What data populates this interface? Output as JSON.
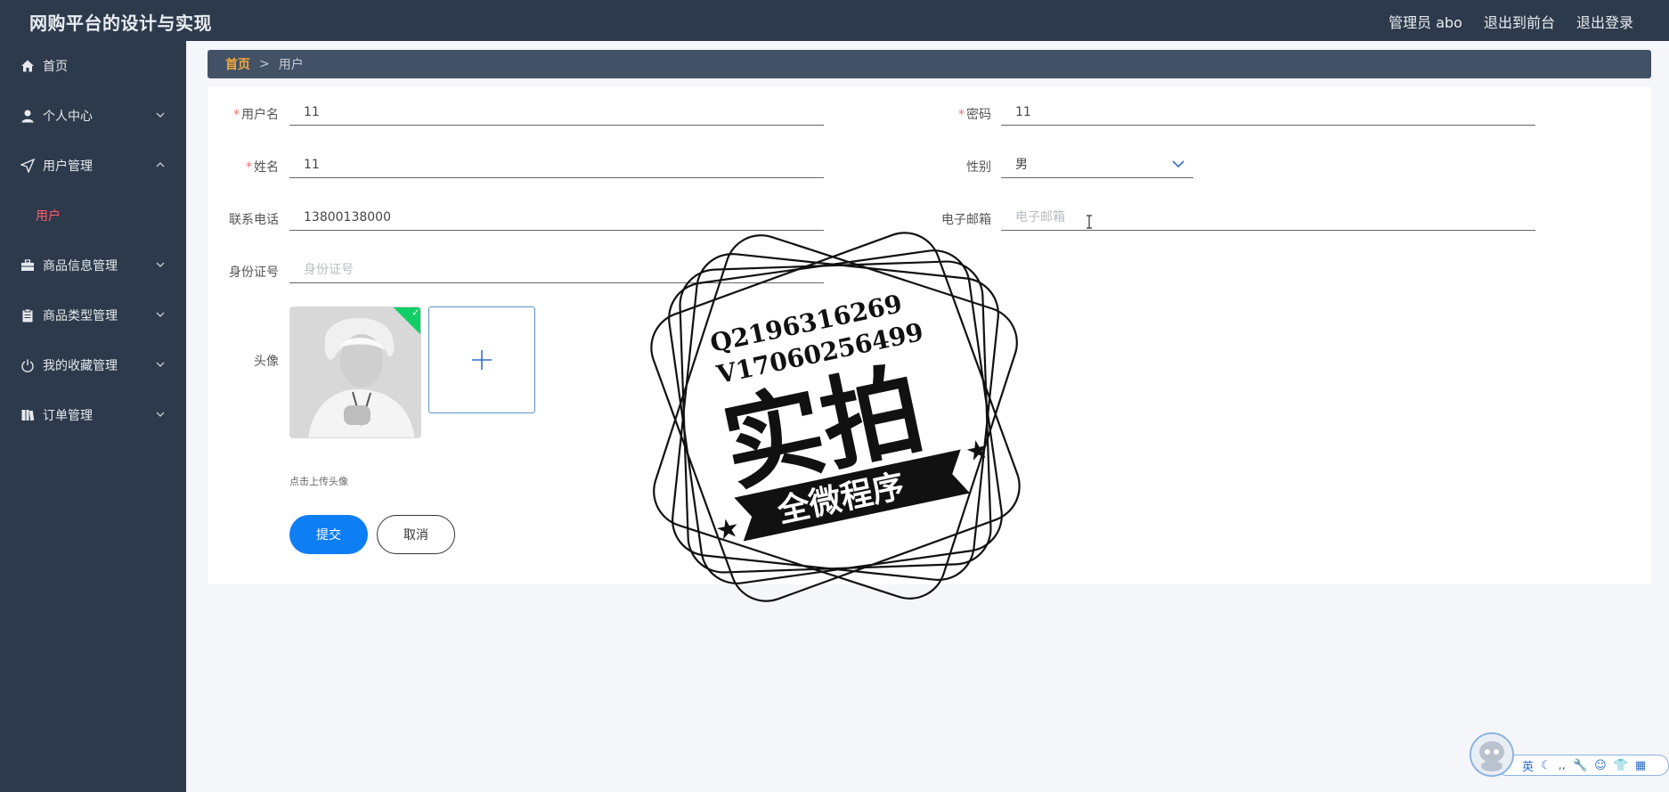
{
  "app": {
    "title": "网购平台的设计与实现"
  },
  "topbar": {
    "user_label": "管理员 abo",
    "to_front_label": "退出到前台",
    "logout_label": "退出登录"
  },
  "sidebar": {
    "items": [
      {
        "label": "首页",
        "icon": "home-icon",
        "expandable": false
      },
      {
        "label": "个人中心",
        "icon": "user-icon",
        "expandable": true
      },
      {
        "label": "用户管理",
        "icon": "send-icon",
        "expandable": true,
        "expanded": true
      },
      {
        "label": "商品信息管理",
        "icon": "briefcase-icon",
        "expandable": true
      },
      {
        "label": "商品类型管理",
        "icon": "clipboard-icon",
        "expandable": true
      },
      {
        "label": "我的收藏管理",
        "icon": "power-icon",
        "expandable": true
      },
      {
        "label": "订单管理",
        "icon": "book-icon",
        "expandable": true
      }
    ],
    "sub_item": "用户",
    "colors": {
      "bg": "#2d3a4b",
      "active_sub": "#ff5b6b"
    }
  },
  "breadcrumb": {
    "home": "首页",
    "separator": ">",
    "current": "用户"
  },
  "form": {
    "username": {
      "label": "用户名",
      "required": true,
      "value": "11"
    },
    "password": {
      "label": "密码",
      "required": true,
      "value": "11"
    },
    "name": {
      "label": "姓名",
      "required": true,
      "value": "11"
    },
    "gender": {
      "label": "性别",
      "value": "男"
    },
    "phone": {
      "label": "联系电话",
      "value": "13800138000"
    },
    "email": {
      "label": "电子邮箱",
      "placeholder": "电子邮箱"
    },
    "idcard": {
      "label": "身份证号",
      "placeholder": "身份证号"
    },
    "avatar": {
      "label": "头像",
      "hint": "点击上传头像",
      "uploaded": true
    },
    "submit_label": "提交",
    "cancel_label": "取消",
    "required_mark": "*",
    "colors": {
      "submit": "#0e7ef5",
      "required": "#f56c6c",
      "breadcrumb_home": "#f2a93b"
    }
  },
  "watermark": {
    "line1": "Q2196316269",
    "line2": "V17060256499",
    "main": "实拍",
    "banner": "全微程序"
  },
  "ime": {
    "lang": "英"
  }
}
